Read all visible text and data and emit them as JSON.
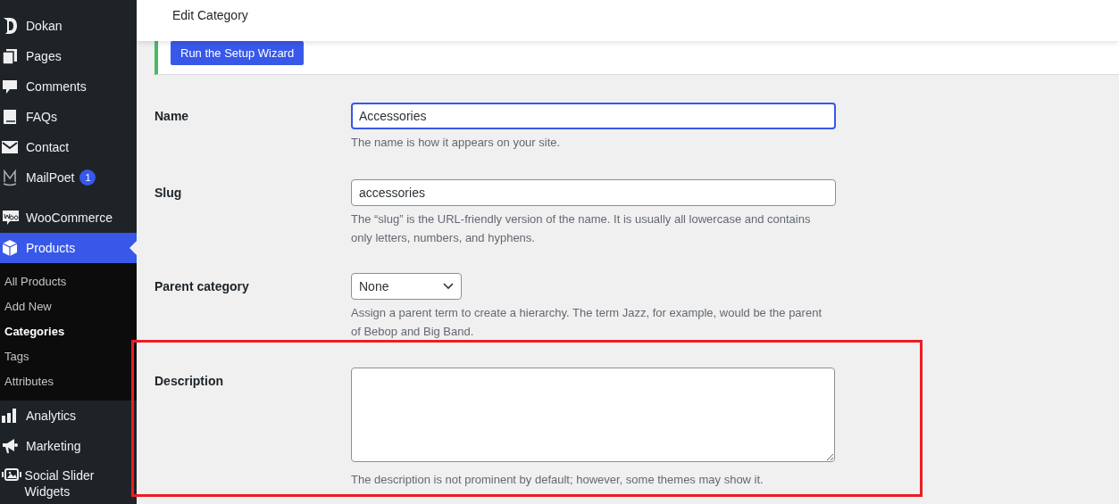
{
  "sidebar": {
    "items": [
      {
        "label": "Dokan",
        "selected": false
      },
      {
        "label": "Pages",
        "selected": false
      },
      {
        "label": "Comments",
        "selected": false
      },
      {
        "label": "FAQs",
        "selected": false
      },
      {
        "label": "Contact",
        "selected": false
      },
      {
        "label": "MailPoet",
        "badge": "1",
        "selected": false
      },
      {
        "label": "WooCommerce",
        "separator_before": true,
        "selected": false
      },
      {
        "label": "Products",
        "selected": true,
        "children": [
          {
            "label": "All Products",
            "selected": false
          },
          {
            "label": "Add New",
            "selected": false
          },
          {
            "label": "Categories",
            "selected": true
          },
          {
            "label": "Tags",
            "selected": false
          },
          {
            "label": "Attributes",
            "selected": false
          }
        ]
      },
      {
        "label": "Analytics",
        "selected": false
      },
      {
        "label": "Marketing",
        "selected": false
      },
      {
        "label": "Social Slider Widgets",
        "selected": false
      }
    ]
  },
  "header": {
    "title": "Edit Category"
  },
  "notice": {
    "button": "Run the Setup Wizard"
  },
  "form": {
    "fields": [
      {
        "kind": "text",
        "label": "Name",
        "value": "Accessories",
        "focused": true,
        "hint": "The name is how it appears on your site."
      },
      {
        "kind": "text",
        "label": "Slug",
        "value": "accessories",
        "focused": false,
        "hint": "The “slug” is the URL-friendly version of the name. It is usually all lowercase and contains only letters, numbers, and hyphens."
      },
      {
        "kind": "select",
        "label": "Parent category",
        "value": "None",
        "focused": false,
        "hint": "Assign a parent term to create a hierarchy. The term Jazz, for example, would be the parent of Bebop and Big Band."
      },
      {
        "kind": "textarea",
        "label": "Description",
        "focused": false,
        "highlighted": true,
        "hint": "The description is not prominent by default; however, some themes may show it."
      }
    ]
  }
}
